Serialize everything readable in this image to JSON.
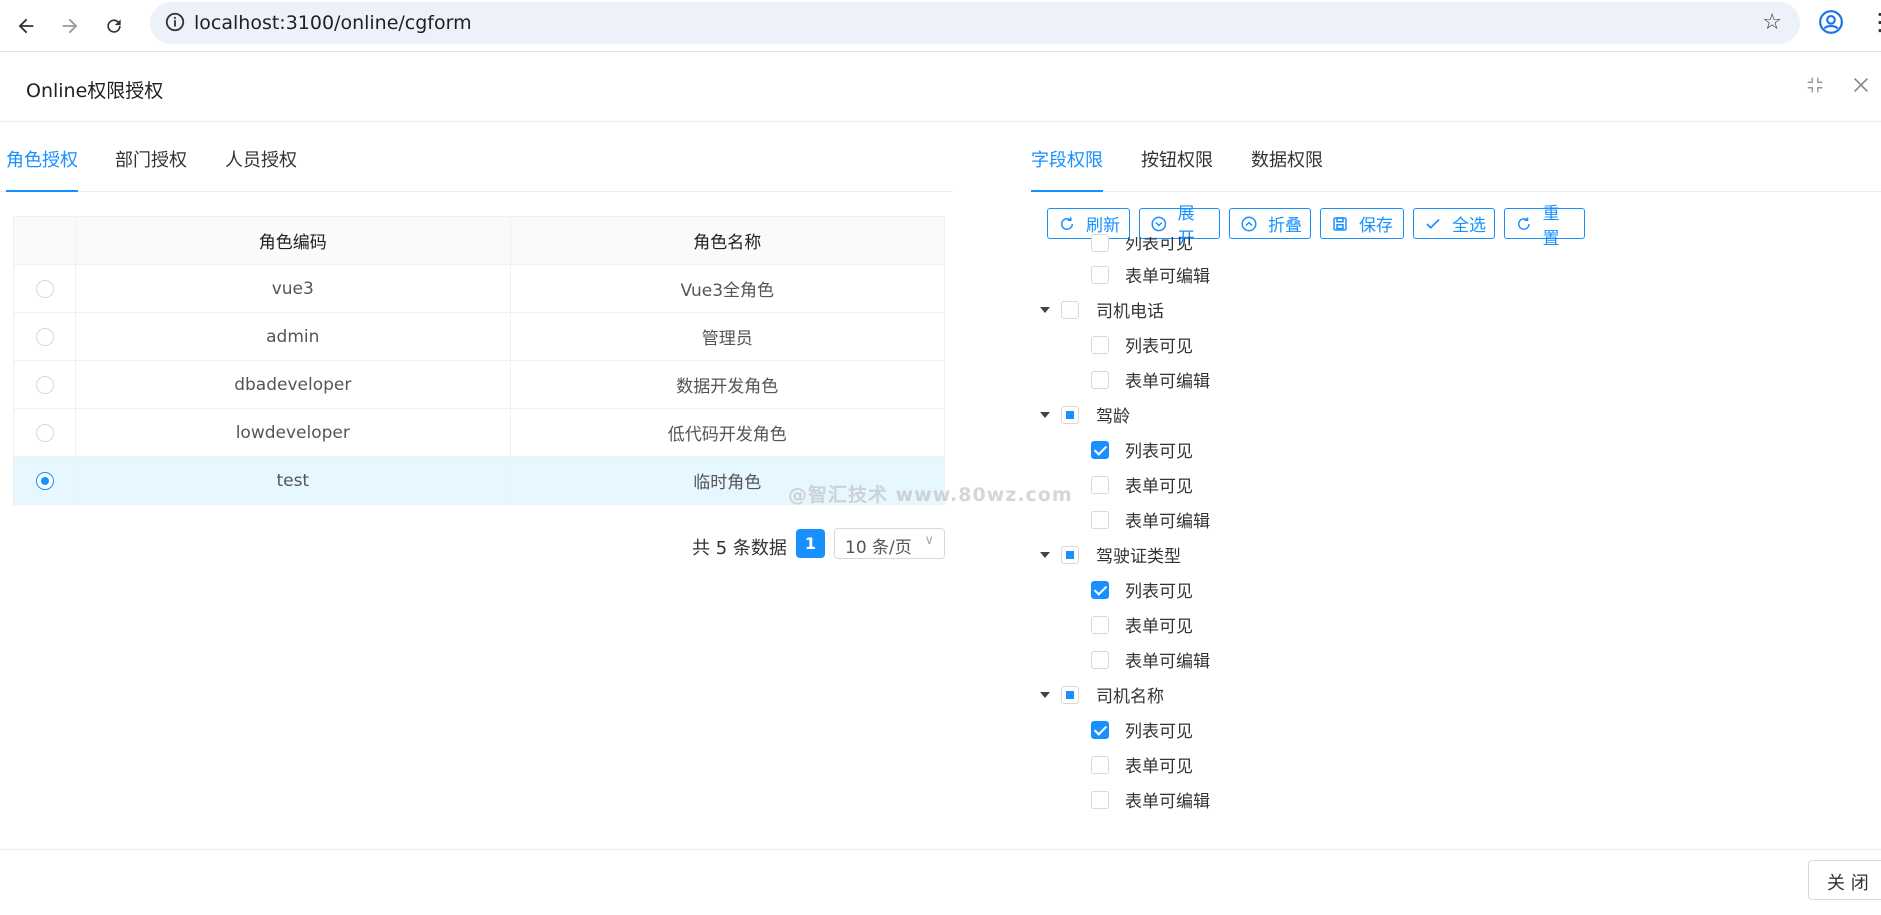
{
  "browser": {
    "url": "localhost:3100/online/cgform"
  },
  "modal": {
    "title": "Online权限授权",
    "close_label": "关 闭"
  },
  "left_tabs": [
    {
      "label": "角色授权",
      "active": true
    },
    {
      "label": "部门授权",
      "active": false
    },
    {
      "label": "人员授权",
      "active": false
    }
  ],
  "role_table": {
    "columns": [
      "角色编码",
      "角色名称"
    ],
    "rows": [
      {
        "code": "vue3",
        "name": "Vue3全角色",
        "selected": false
      },
      {
        "code": "admin",
        "name": "管理员",
        "selected": false
      },
      {
        "code": "dbadeveloper",
        "name": "数据开发角色",
        "selected": false
      },
      {
        "code": "lowdeveloper",
        "name": "低代码开发角色",
        "selected": false
      },
      {
        "code": "test",
        "name": "临时角色",
        "selected": true
      }
    ]
  },
  "pagination": {
    "total_text": "共 5 条数据",
    "current_page": "1",
    "page_size": "10 条/页"
  },
  "right_tabs": [
    {
      "label": "字段权限",
      "active": true
    },
    {
      "label": "按钮权限",
      "active": false
    },
    {
      "label": "数据权限",
      "active": false
    }
  ],
  "toolbar": {
    "refresh": "刷新",
    "expand": "展开",
    "collapse": "折叠",
    "save": "保存",
    "select_all": "全选",
    "reset": "重置"
  },
  "tree": [
    {
      "label": "列表可见",
      "level": 2,
      "state": "unchecked"
    },
    {
      "label": "表单可编辑",
      "level": 2,
      "state": "unchecked"
    },
    {
      "label": "司机电话",
      "level": 1,
      "state": "unchecked"
    },
    {
      "label": "列表可见",
      "level": 2,
      "state": "unchecked"
    },
    {
      "label": "表单可编辑",
      "level": 2,
      "state": "unchecked"
    },
    {
      "label": "驾龄",
      "level": 1,
      "state": "partial"
    },
    {
      "label": "列表可见",
      "level": 2,
      "state": "checked"
    },
    {
      "label": "表单可见",
      "level": 2,
      "state": "unchecked"
    },
    {
      "label": "表单可编辑",
      "level": 2,
      "state": "unchecked"
    },
    {
      "label": "驾驶证类型",
      "level": 1,
      "state": "partial"
    },
    {
      "label": "列表可见",
      "level": 2,
      "state": "checked"
    },
    {
      "label": "表单可见",
      "level": 2,
      "state": "unchecked"
    },
    {
      "label": "表单可编辑",
      "level": 2,
      "state": "unchecked"
    },
    {
      "label": "司机名称",
      "level": 1,
      "state": "partial"
    },
    {
      "label": "列表可见",
      "level": 2,
      "state": "checked"
    },
    {
      "label": "表单可见",
      "level": 2,
      "state": "unchecked"
    },
    {
      "label": "表单可编辑",
      "level": 2,
      "state": "unchecked"
    }
  ],
  "watermark": "@智汇技术 www.80wz.com",
  "colors": {
    "accent": "#1890ff",
    "selected_row": "#e6f7ff"
  }
}
